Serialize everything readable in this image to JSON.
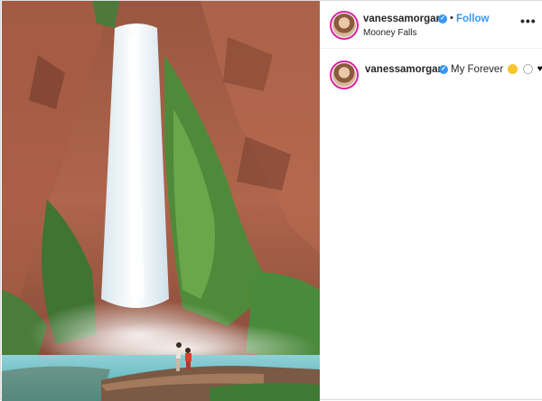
{
  "post": {
    "username": "vanessamorgan",
    "verified_glyph": "✓",
    "separator": "•",
    "follow_label": "Follow",
    "location": "Mooney Falls",
    "more_label": "•••",
    "caption_text": "My Forever",
    "caption_emojis": [
      "crying-laughing-face-emoji",
      "ring-emoji",
      "black-heart-emoji"
    ],
    "heart_glyph": "♥"
  },
  "photo": {
    "subject": "waterfall-photo"
  },
  "colors": {
    "link_blue": "#3897f0",
    "story_ring": "#d6249f",
    "border": "#dbdbdb"
  }
}
